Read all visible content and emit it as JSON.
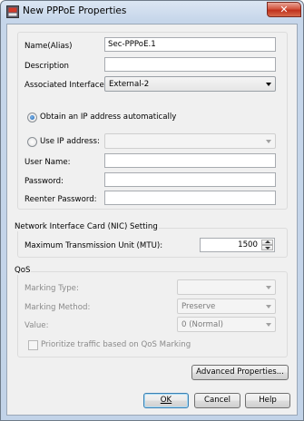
{
  "window": {
    "title": "New PPPoE Properties",
    "close_glyph": "✕"
  },
  "general": {
    "name_label": "Name(Alias)",
    "name_value": "Sec-PPPoE.1",
    "description_label": "Description",
    "description_value": "",
    "interface_label": "Associated Interface",
    "interface_value": "External-2",
    "obtain_auto_label": "Obtain an IP address automatically",
    "use_ip_label": "Use IP address:",
    "use_ip_value": "",
    "username_label": "User Name:",
    "username_value": "",
    "password_label": "Password:",
    "password_value": "",
    "reenter_label": "Reenter Password:",
    "reenter_value": ""
  },
  "nic": {
    "title": "Network Interface Card (NIC) Setting",
    "mtu_label": "Maximum Transmission Unit (MTU):",
    "mtu_value": "1500"
  },
  "qos": {
    "title": "QoS",
    "marking_type_label": "Marking Type:",
    "marking_type_value": "",
    "marking_method_label": "Marking Method:",
    "marking_method_value": "Preserve",
    "value_label": "Value:",
    "value_value": "0 (Normal)",
    "prioritize_label": "Prioritize traffic based on QoS Marking"
  },
  "buttons": {
    "advanced": "Advanced Properties...",
    "ok": "OK",
    "cancel": "Cancel",
    "help": "Help"
  },
  "colors": {
    "title_bar": "#c6d6ea",
    "close_button": "#c0311c",
    "dialog_bg": "#f0f0f0",
    "radio_selected": "#1a5fb0"
  }
}
